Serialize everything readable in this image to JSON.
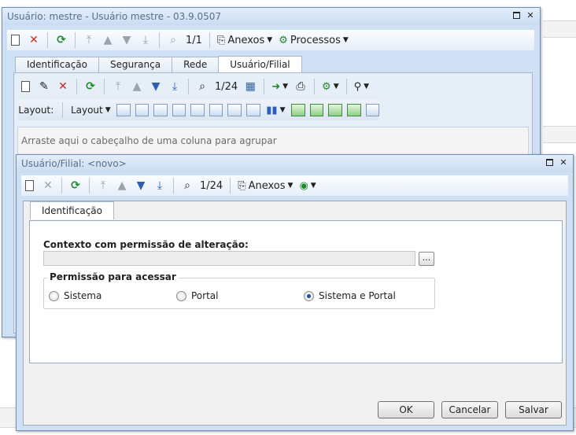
{
  "bg_window": {
    "title": "Usuário: mestre - Usuário mestre - 03.9.0507",
    "toolbar": {
      "page": "1/1",
      "anexos": "Anexos",
      "processos": "Processos"
    },
    "tabs": [
      "Identificação",
      "Segurança",
      "Rede",
      "Usuário/Filial"
    ],
    "sub_toolbar": {
      "page": "1/24"
    },
    "layout_bar": {
      "layout_label": "Layout:",
      "layout_menu": "Layout"
    },
    "group_hint": "Arraste aqui o cabeçalho de uma coluna para agrupar"
  },
  "dialog": {
    "title": "Usuário/Filial: <novo>",
    "toolbar": {
      "page": "1/24",
      "anexos": "Anexos"
    },
    "tab": "Identificação",
    "context_label": "Contexto com permissão de alteração:",
    "context_value": "",
    "browse_label": "...",
    "permission_group": {
      "title": "Permissão para acessar",
      "options": [
        "Sistema",
        "Portal",
        "Sistema e Portal"
      ],
      "selected": "Sistema e Portal"
    },
    "buttons": {
      "ok": "OK",
      "cancel": "Cancelar",
      "save": "Salvar"
    }
  },
  "colors": {
    "window_frame": "#cfe0f4",
    "title_text": "#5a6f89",
    "accent": "#1d4f9a"
  }
}
